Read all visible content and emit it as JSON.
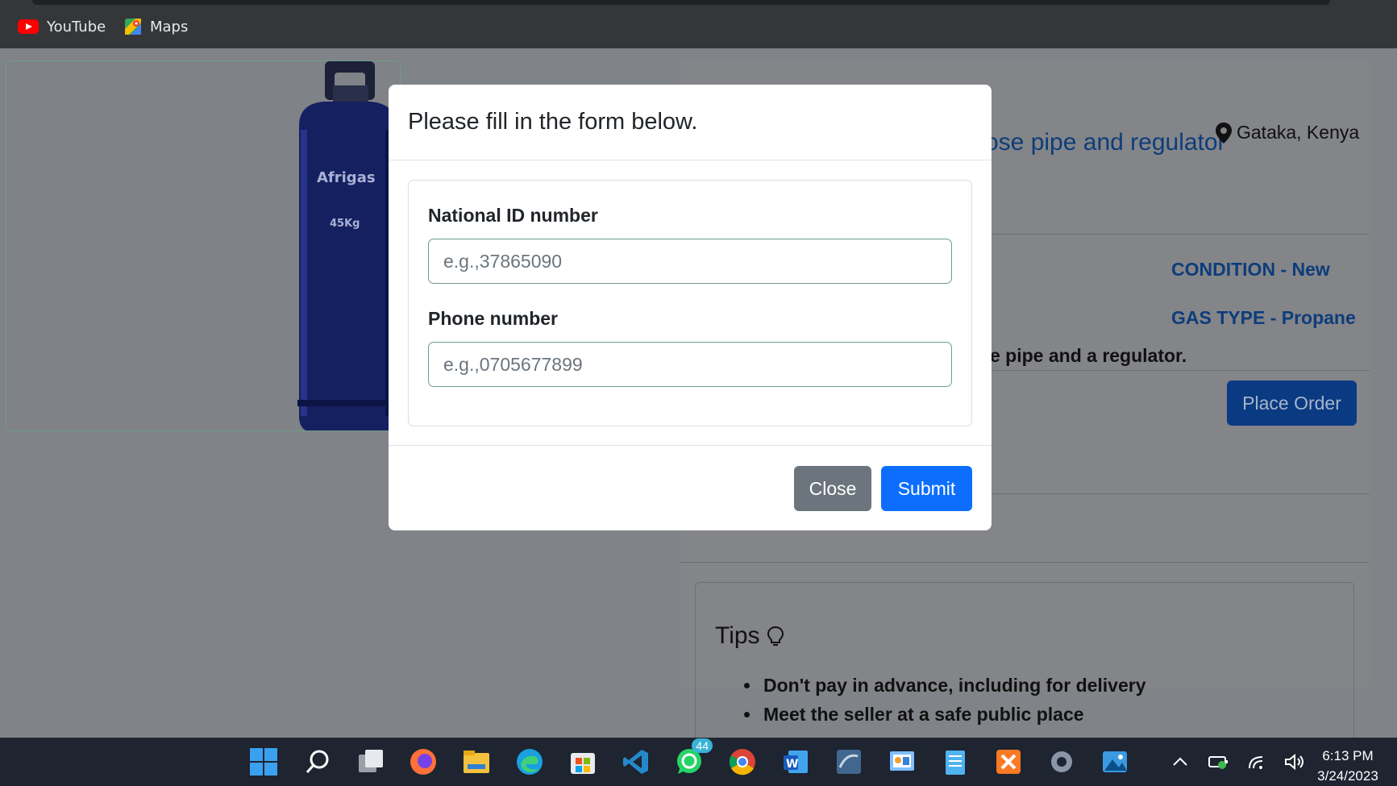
{
  "bookmarks": [
    {
      "label": "YouTube",
      "icon": "youtube-icon"
    },
    {
      "label": "Maps",
      "icon": "maps-icon"
    }
  ],
  "product": {
    "image_brand": "Afrigas",
    "image_weight": "45Kg",
    "title_partial": "ose pipe and regulator",
    "location": "Gataka, Kenya",
    "condition": "CONDITION - New",
    "gas_type": "GAS TYPE - Propane",
    "description_partial": "e pipe and a regulator.",
    "place_order_label": "Place Order"
  },
  "tips": {
    "title": "Tips",
    "items": [
      "Don't pay in advance, including for delivery",
      "Meet the seller at a safe public place"
    ]
  },
  "modal": {
    "title": "Please fill in the form below.",
    "fields": [
      {
        "label": "National ID number",
        "placeholder": "e.g.,37865090"
      },
      {
        "label": "Phone number",
        "placeholder": "e.g.,0705677899"
      }
    ],
    "close_label": "Close",
    "submit_label": "Submit"
  },
  "taskbar": {
    "icons": [
      "windows-start-icon",
      "search-icon",
      "task-view-icon",
      "firefox-icon",
      "file-explorer-icon",
      "edge-icon",
      "microsoft-store-icon",
      "vscode-icon",
      "whatsapp-icon",
      "chrome-icon",
      "word-icon",
      "mysql-workbench-icon",
      "control-panel-icon",
      "notepad-icon",
      "xampp-icon",
      "settings-icon",
      "photos-icon"
    ],
    "whatsapp_badge": "44",
    "time": "6:13 PM",
    "date": "3/24/2023"
  },
  "colors": {
    "primary": "#0d6efd",
    "secondary": "#6c757d",
    "backdrop": "#808387",
    "taskbar": "#1e2430"
  }
}
